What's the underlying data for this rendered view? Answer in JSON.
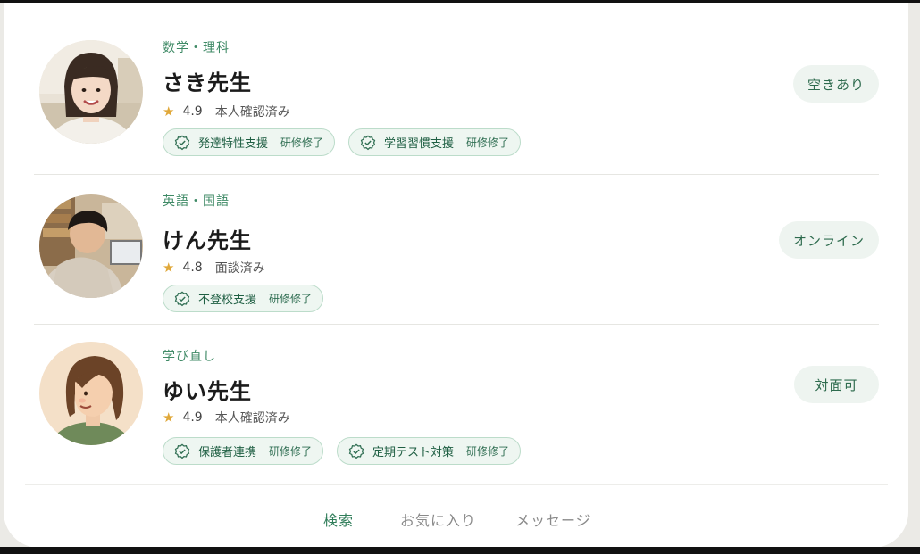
{
  "teachers": [
    {
      "subject": "数学・理科",
      "name": "さき先生",
      "rating": "4.9",
      "verification": "本人確認済み",
      "status": "空きあり",
      "tags": [
        {
          "label": "発達特性支援",
          "sub": "研修修了"
        },
        {
          "label": "学習習慣支援",
          "sub": "研修修了"
        }
      ]
    },
    {
      "subject": "英語・国語",
      "name": "けん先生",
      "rating": "4.8",
      "verification": "面談済み",
      "status": "オンライン",
      "tags": [
        {
          "label": "不登校支援",
          "sub": "研修修了"
        }
      ]
    },
    {
      "subject": "学び直し",
      "name": "ゆい先生",
      "rating": "4.9",
      "verification": "本人確認済み",
      "status": "対面可",
      "tags": [
        {
          "label": "保護者連携",
          "sub": "研修修了"
        },
        {
          "label": "定期テスト対策",
          "sub": "研修修了"
        }
      ]
    }
  ],
  "nav": {
    "search": "検索",
    "favorites": "お気に入り",
    "messages": "メッセージ"
  },
  "colors": {
    "accent": "#3f8a66",
    "star": "#e0a83a",
    "tag_bg": "#eef6f1",
    "tag_border": "#bcdcca",
    "status_bg": "#eef4f0"
  },
  "icons": {
    "star": "star-icon",
    "badge": "verified-check-icon"
  }
}
